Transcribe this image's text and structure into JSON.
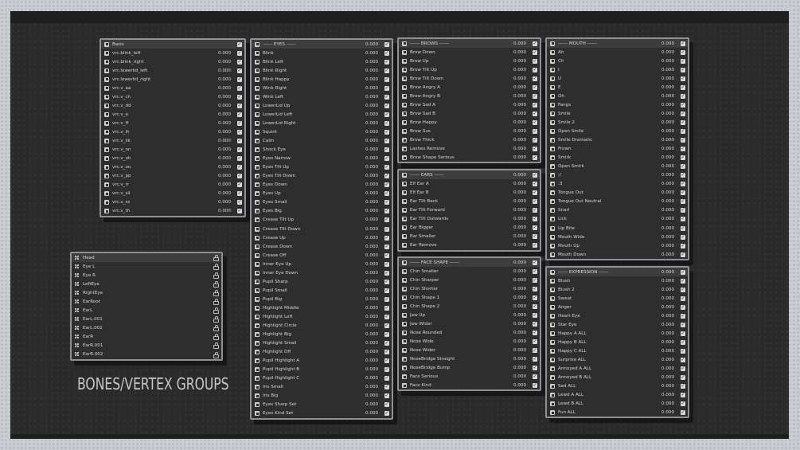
{
  "caption": "BONES/VERTEX GROUPS",
  "colors": {
    "panel_bg": "#2e2e2e",
    "panel_border": "#8d9096",
    "stage_bg": "#2a2a2a",
    "text": "#d6d6d6"
  },
  "panels": {
    "basis": {
      "rows": [
        {
          "name": "Basis",
          "value": ""
        },
        {
          "name": "vrc.blink_left",
          "value": "0.000"
        },
        {
          "name": "vrc.blink_right",
          "value": "0.000"
        },
        {
          "name": "vrc.lowerlid_left",
          "value": "0.000"
        },
        {
          "name": "vrc.lowerlid_right",
          "value": "0.000"
        },
        {
          "name": "vrc.v_aa",
          "value": "0.000"
        },
        {
          "name": "vrc.v_ch",
          "value": "0.000"
        },
        {
          "name": "vrc.v_dd",
          "value": "0.000"
        },
        {
          "name": "vrc.v_e",
          "value": "0.000"
        },
        {
          "name": "vrc.v_ff",
          "value": "0.000"
        },
        {
          "name": "vrc.v_ih",
          "value": "0.000"
        },
        {
          "name": "vrc.v_kk",
          "value": "0.000"
        },
        {
          "name": "vrc.v_nn",
          "value": "0.000"
        },
        {
          "name": "vrc.v_oh",
          "value": "0.000"
        },
        {
          "name": "vrc.v_ou",
          "value": "0.000"
        },
        {
          "name": "vrc.v_pp",
          "value": "0.000"
        },
        {
          "name": "vrc.v_rr",
          "value": "0.000"
        },
        {
          "name": "vrc.v_sil",
          "value": "0.000"
        },
        {
          "name": "vrc.v_ss",
          "value": "0.000"
        },
        {
          "name": "vrc.v_th",
          "value": "0.000"
        }
      ]
    },
    "eyes": {
      "rows": [
        {
          "name": "------ EYES ------",
          "value": "0.000"
        },
        {
          "name": "Blink",
          "value": "0.000"
        },
        {
          "name": "Blink Left",
          "value": "0.000"
        },
        {
          "name": "Blink Right",
          "value": "0.000"
        },
        {
          "name": "Blink Happy",
          "value": "0.000"
        },
        {
          "name": "Wink Right",
          "value": "0.000"
        },
        {
          "name": "Wink Left",
          "value": "0.000"
        },
        {
          "name": "LowerLid Up",
          "value": "0.000"
        },
        {
          "name": "LowerLid Left",
          "value": "0.000"
        },
        {
          "name": "LowerLid Right",
          "value": "0.000"
        },
        {
          "name": "Squint",
          "value": "0.000"
        },
        {
          "name": "Calm",
          "value": "0.000"
        },
        {
          "name": "Shock Eye",
          "value": "0.000"
        },
        {
          "name": "Eyes Narrow",
          "value": "0.000"
        },
        {
          "name": "Eyes Tilt Up",
          "value": "0.000"
        },
        {
          "name": "Eyes Tilt Down",
          "value": "0.000"
        },
        {
          "name": "Eyes Down",
          "value": "0.000"
        },
        {
          "name": "Eyes Up",
          "value": "0.000"
        },
        {
          "name": "Eyes Small",
          "value": "0.000"
        },
        {
          "name": "Eyes Big",
          "value": "0.000"
        },
        {
          "name": "Crease Tilt Up",
          "value": "0.000"
        },
        {
          "name": "Crease Tilt Down",
          "value": "0.000"
        },
        {
          "name": "Crease Up",
          "value": "0.000"
        },
        {
          "name": "Crease Down",
          "value": "0.000"
        },
        {
          "name": "Crease Off",
          "value": "0.000"
        },
        {
          "name": "Inner Eye Up",
          "value": "0.000"
        },
        {
          "name": "Inner Eye Down",
          "value": "0.000"
        },
        {
          "name": "Pupil Sharp",
          "value": "0.000"
        },
        {
          "name": "Pupil Small",
          "value": "0.000"
        },
        {
          "name": "Pupil Big",
          "value": "0.000"
        },
        {
          "name": "Highlight Middle",
          "value": "0.000"
        },
        {
          "name": "Highlight Left",
          "value": "0.000"
        },
        {
          "name": "Highlight Circle",
          "value": "0.000"
        },
        {
          "name": "Highlight Big",
          "value": "0.000"
        },
        {
          "name": "Highlight Small",
          "value": "0.000"
        },
        {
          "name": "Highlight Off",
          "value": "0.000"
        },
        {
          "name": "Pupil Highlight A",
          "value": "0.000"
        },
        {
          "name": "Pupil Highlight B",
          "value": "0.000"
        },
        {
          "name": "Pupil Highlight C",
          "value": "0.000"
        },
        {
          "name": "Iris Small",
          "value": "0.000"
        },
        {
          "name": "Iris Big",
          "value": "0.000"
        },
        {
          "name": "Eyes Sharp Set",
          "value": "0.000"
        },
        {
          "name": "Eyes Kind Set",
          "value": "0.000"
        }
      ]
    },
    "brows": {
      "rows": [
        {
          "name": "------ BROWS ------",
          "value": "0.000"
        },
        {
          "name": "Brow Down",
          "value": "0.000"
        },
        {
          "name": "Brow Up",
          "value": "0.000"
        },
        {
          "name": "Brow Tilt Up",
          "value": "0.000"
        },
        {
          "name": "Brow Tilt Down",
          "value": "0.000"
        },
        {
          "name": "Brow Angry A",
          "value": "0.000"
        },
        {
          "name": "Brow Angry B",
          "value": "0.000"
        },
        {
          "name": "Brow Sad A",
          "value": "0.000"
        },
        {
          "name": "Brow Sad B",
          "value": "0.000"
        },
        {
          "name": "Brow Happy",
          "value": "0.000"
        },
        {
          "name": "Brow Sus",
          "value": "0.000"
        },
        {
          "name": "Brow Thick",
          "value": "0.000"
        },
        {
          "name": "Lashes Remove",
          "value": "0.000"
        },
        {
          "name": "Brow Shape Serious",
          "value": "0.000"
        }
      ]
    },
    "ears": {
      "rows": [
        {
          "name": "------ EARS ------",
          "value": "0.000"
        },
        {
          "name": "Elf Ear A",
          "value": "0.000"
        },
        {
          "name": "Elf Ear B",
          "value": "0.000"
        },
        {
          "name": "Ear Tilt Back",
          "value": "0.000"
        },
        {
          "name": "Ear Tilt Forward",
          "value": "0.000"
        },
        {
          "name": "Ear Tilt Outwards",
          "value": "0.000"
        },
        {
          "name": "Ear Bigger",
          "value": "0.000"
        },
        {
          "name": "Ear Smaller",
          "value": "0.000"
        },
        {
          "name": "Ear Remove",
          "value": "0.000"
        }
      ]
    },
    "face": {
      "rows": [
        {
          "name": "------ FACE SHAPE ------",
          "value": "0.000"
        },
        {
          "name": "Chin Smaller",
          "value": "0.000"
        },
        {
          "name": "Chin Sharper",
          "value": "0.000"
        },
        {
          "name": "Chin Shorter",
          "value": "0.000"
        },
        {
          "name": "Chin Shape 1",
          "value": "0.000"
        },
        {
          "name": "Chin Shape 2",
          "value": "0.000"
        },
        {
          "name": "Jaw Up",
          "value": "0.000"
        },
        {
          "name": "Jaw Wider",
          "value": "0.000"
        },
        {
          "name": "Nose Rounded",
          "value": "0.000"
        },
        {
          "name": "Nose Wide",
          "value": "0.000"
        },
        {
          "name": "Nose Wider",
          "value": "0.000"
        },
        {
          "name": "NoseBridge Straight",
          "value": "0.000"
        },
        {
          "name": "NoseBridge Bump",
          "value": "0.000"
        },
        {
          "name": "Face Serious",
          "value": "0.000"
        },
        {
          "name": "Face Kind",
          "value": "0.000"
        }
      ]
    },
    "mouth": {
      "rows": [
        {
          "name": "------ MOUTH ------",
          "value": "0.000"
        },
        {
          "name": "Ah",
          "value": "0.000"
        },
        {
          "name": "Ch",
          "value": "0.000"
        },
        {
          "name": "I",
          "value": "0.000"
        },
        {
          "name": "U",
          "value": "0.000"
        },
        {
          "name": "E",
          "value": "0.000"
        },
        {
          "name": "Oh",
          "value": "0.000"
        },
        {
          "name": "Fangs",
          "value": "0.000"
        },
        {
          "name": "Smile",
          "value": "0.000"
        },
        {
          "name": "Smile 2",
          "value": "0.000"
        },
        {
          "name": "Open Smile",
          "value": "0.000"
        },
        {
          "name": "Smile Dramatic",
          "value": "0.000"
        },
        {
          "name": "Frown",
          "value": "0.000"
        },
        {
          "name": "Smirk",
          "value": "0.000"
        },
        {
          "name": "Open Smirk",
          "value": "0.000"
        },
        {
          "name": ":/",
          "value": "0.000"
        },
        {
          "name": ":3",
          "value": "0.000"
        },
        {
          "name": "Tongue Out",
          "value": "0.000"
        },
        {
          "name": "Tongue Out Neutral",
          "value": "0.000"
        },
        {
          "name": "Snarl",
          "value": "0.000"
        },
        {
          "name": "Lick",
          "value": "0.000"
        },
        {
          "name": "Lip Bite",
          "value": "0.000"
        },
        {
          "name": "Mouth Wide",
          "value": "0.000"
        },
        {
          "name": "Mouth Up",
          "value": "0.000"
        },
        {
          "name": "Mouth Down",
          "value": "0.000"
        }
      ]
    },
    "expression": {
      "rows": [
        {
          "name": "------ EXPRESSION ------",
          "value": "0.000"
        },
        {
          "name": "Blush",
          "value": "0.000"
        },
        {
          "name": "Blush 2",
          "value": "0.000"
        },
        {
          "name": "Sweat",
          "value": "0.000"
        },
        {
          "name": "Anger",
          "value": "0.000"
        },
        {
          "name": "Heart Eye",
          "value": "0.000"
        },
        {
          "name": "Star Eye",
          "value": "0.000"
        },
        {
          "name": "Happy A ALL",
          "value": "0.000"
        },
        {
          "name": "Happy B ALL",
          "value": "0.000"
        },
        {
          "name": "Happy C ALL",
          "value": "0.000"
        },
        {
          "name": "Surprise ALL",
          "value": "0.000"
        },
        {
          "name": "Annoyed A ALL",
          "value": "0.000"
        },
        {
          "name": "Annoyed B ALL",
          "value": "0.000"
        },
        {
          "name": "Sad ALL",
          "value": "0.000"
        },
        {
          "name": "Lewd A ALL",
          "value": "0.000"
        },
        {
          "name": "Lewd B ALL",
          "value": "0.000"
        },
        {
          "name": "Fun ALL",
          "value": "0.000"
        }
      ]
    },
    "bones": {
      "rows": [
        {
          "name": "Head"
        },
        {
          "name": "Eye L"
        },
        {
          "name": "Eye R"
        },
        {
          "name": "LeftEye"
        },
        {
          "name": "RightEye"
        },
        {
          "name": "EarRoot"
        },
        {
          "name": "EarL"
        },
        {
          "name": "EarL.001"
        },
        {
          "name": "EarL.002"
        },
        {
          "name": "EarR"
        },
        {
          "name": "EarR.001"
        },
        {
          "name": "EarR.002"
        }
      ]
    }
  }
}
